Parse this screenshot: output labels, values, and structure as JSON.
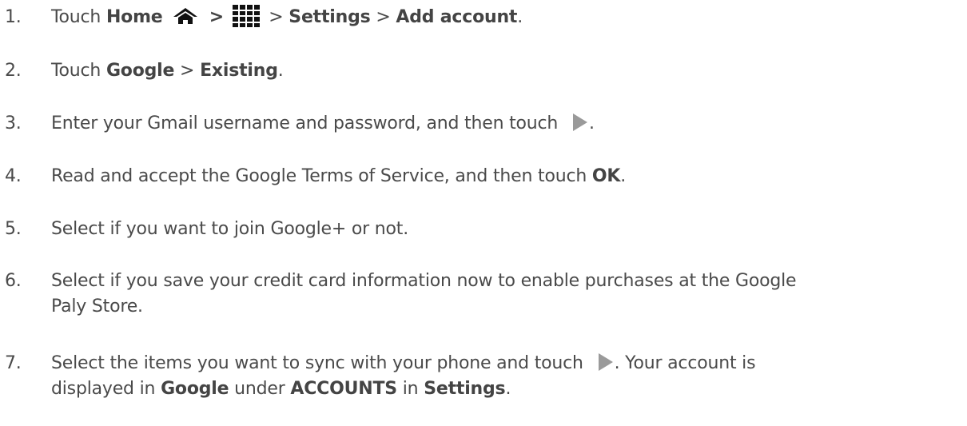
{
  "steps": [
    {
      "num": "1.",
      "t1": "Touch ",
      "b1": "Home",
      "gt1": " > ",
      "gt2": " > ",
      "b2": "Settings",
      "gt3": " > ",
      "b3": "Add account",
      "end": "."
    },
    {
      "num": "2.",
      "t1": "Touch ",
      "b1": "Google",
      "gt1": " > ",
      "b2": "Existing",
      "end": "."
    },
    {
      "num": "3.",
      "t1": "Enter your Gmail username and password, and then touch",
      "end": "."
    },
    {
      "num": "4.",
      "t1": "Read and accept the Google Terms of Service, and then touch ",
      "b1": "OK",
      "end": "."
    },
    {
      "num": "5.",
      "t1": "Select if you want to join Google+ or not."
    },
    {
      "num": "6.",
      "line1": "Select if you save your credit card information now to enable purchases at the Google",
      "line2": "Paly Store."
    },
    {
      "num": "7.",
      "t1": "Select the items you want to sync with your phone and touch",
      "t2": ". Your account is",
      "t3": "displayed in ",
      "b1": "Google",
      "t4": " under ",
      "b2": "ACCOUNTS",
      "t5": " in ",
      "b3": "Settings",
      "end": "."
    }
  ],
  "icons": {
    "home": "home-icon",
    "apps": "apps-grid-icon",
    "next": "next-arrow-icon"
  },
  "colors": {
    "text": "#4a4a4a",
    "icon": "#111111",
    "arrow": "#9a9a9a"
  }
}
